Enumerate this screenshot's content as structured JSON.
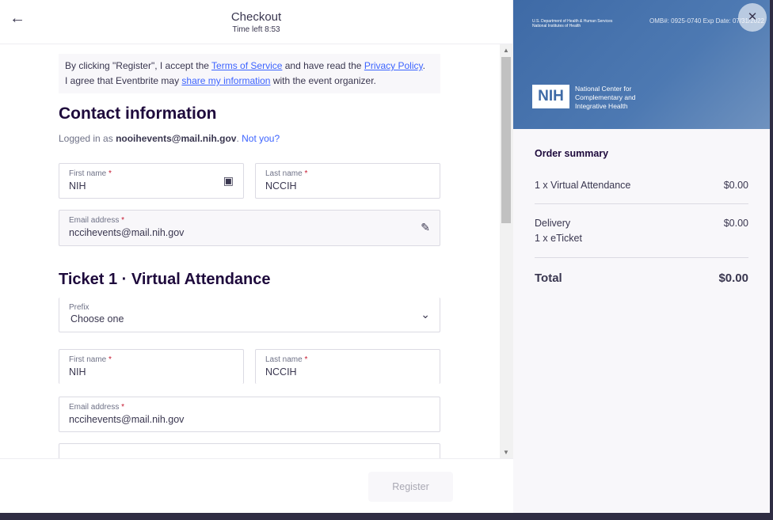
{
  "header": {
    "title": "Checkout",
    "timer": "Time left 8:53"
  },
  "notice": {
    "p1": "By clicking \"Register\", I accept the ",
    "tos": "Terms of Service",
    "p2": " and have read the ",
    "privacy": "Privacy Policy",
    "p3": ".",
    "p4": "I agree that Eventbrite may ",
    "share": "share my information",
    "p5": " with the event organizer."
  },
  "contact": {
    "heading": "Contact information",
    "logged_prefix": "Logged in as ",
    "email_bold": "nooihevents@mail.nih.gov",
    "not_you": "Not you?",
    "first_label": "First name",
    "first": "NIH",
    "last_label": "Last name",
    "last": "NCCIH",
    "email_label": "Email address",
    "email": "nccihevents@mail.nih.gov"
  },
  "ticket": {
    "heading": "Ticket 1 · Virtual Attendance",
    "prefix_label": "Prefix",
    "prefix_value": "Choose one",
    "first_label": "First name",
    "first": "NIH",
    "last_label": "Last name",
    "last": "NCCIH",
    "email_label": "Email address",
    "email": "nccihevents@mail.nih.gov"
  },
  "required_mark": "*",
  "footer": {
    "register": "Register"
  },
  "banner": {
    "dept": "U.S. Department of Health & Human Services",
    "inst": "National Institutes of Health",
    "omb": "OMB#: 0925-0740 Exp Date: 07/31/2022",
    "logo": "NIH",
    "org1": "National Center for",
    "org2": "Complementary and",
    "org3": "Integrative Health"
  },
  "summary": {
    "title": "Order summary",
    "item": "1 x Virtual Attendance",
    "item_price": "$0.00",
    "delivery": "Delivery",
    "delivery_price": "$0.00",
    "delivery_item": "1 x eTicket",
    "total_label": "Total",
    "total": "$0.00"
  }
}
